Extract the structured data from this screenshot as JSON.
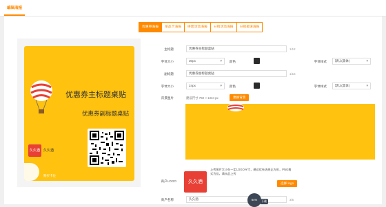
{
  "window": {
    "title": "编辑海报"
  },
  "tabs": [
    {
      "label": "优惠券海报",
      "active": true
    },
    {
      "label": "单品卡海报",
      "active": false
    },
    {
      "label": "拼团活动海报",
      "active": false
    },
    {
      "label": "分销活动海报",
      "active": false
    },
    {
      "label": "分销邀请海报",
      "active": false
    }
  ],
  "poster": {
    "main_title": "优惠券主标题桌贴",
    "sub_title": "优惠券副标题桌贴",
    "brand_logo_text": "久久酒",
    "brand_name": "久久酒",
    "buy_tag": "购买卡位"
  },
  "form": {
    "main_title_label": "主标题",
    "main_title_value": "优惠券主标题桌贴",
    "main_title_count": "1/12",
    "font_size_label": "字体大小",
    "font_size_value": "30px",
    "color_label": "颜色",
    "font_style_label": "字体样式",
    "font_style_value": "默认(黑体)",
    "sub_title_label": "副标题",
    "sub_title_value": "优惠券副标题桌贴",
    "sub_title_count": "1/16",
    "font_size2_label": "字体大小",
    "font_size2_value": "24px",
    "color2_label": "颜色",
    "font_style2_label": "字体样式",
    "font_style2_value": "默认(黑体)",
    "bg_label": "背景图片",
    "bg_hint": "建议尺寸 750 × 1334 px",
    "bg_upload": "更换背景",
    "logo_label": "商户LOGO",
    "logo_text": "久久酒",
    "logo_upload": "选择 logo",
    "logo_hint": "上传图片大小在一定LOGO尺寸，建议优先选择正方形，PNG格式为佳，请从此上传",
    "merchant_label": "商户名称",
    "merchant_value": "久久酒",
    "merchant_count": "3/5"
  },
  "floating": {
    "stats": "64%",
    "badge": "下载"
  },
  "colors": {
    "accent": "#ff8a00",
    "poster_bg": "#ffc20e",
    "logo_red": "#e84035"
  }
}
